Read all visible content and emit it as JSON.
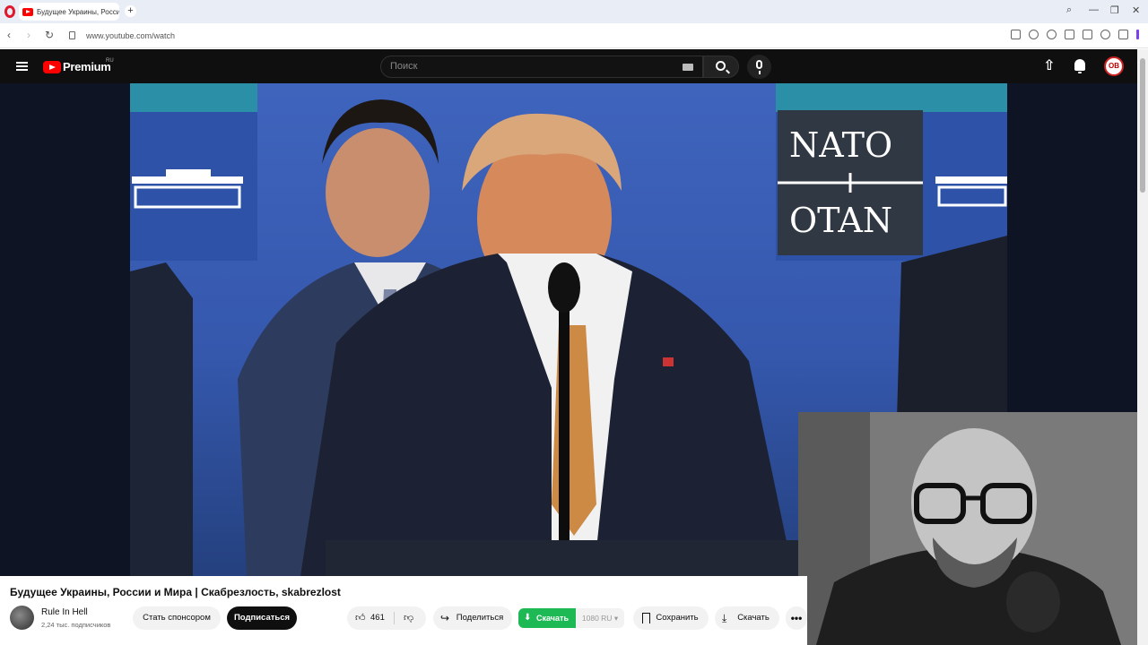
{
  "browser": {
    "tab_title": "Будущее Украины, Росси",
    "new_tab": "+",
    "url": "www.youtube.com/watch",
    "search_icon": "⌕",
    "minimize": "—",
    "restore": "❐",
    "close": "✕"
  },
  "youtube": {
    "brand": "Premium",
    "region": "RU",
    "search_placeholder": "Поиск",
    "upload_icon": "⇧",
    "avatar_initials": "OB"
  },
  "video": {
    "banner_top": "NATO",
    "banner_bottom": "OTAN"
  },
  "info": {
    "title": "Будущее Украины, России и Мира | Скабрезлость, skabrezlost",
    "channel_name": "Rule In Hell",
    "subscribers": "2,24 тыс. подписчиков",
    "sponsor_label": "Стать спонсором",
    "subscribe_label": "Подписаться",
    "like_count": "461",
    "share_label": "Поделиться",
    "download_green_label": "Скачать",
    "download_quality": "1080 RU",
    "save_label": "Сохранить",
    "download_label": "Скачать",
    "more_label": "•••"
  },
  "colors": {
    "youtube_red": "#ff0000",
    "download_green": "#1db954",
    "browser_accent": "#7b3ff2"
  }
}
